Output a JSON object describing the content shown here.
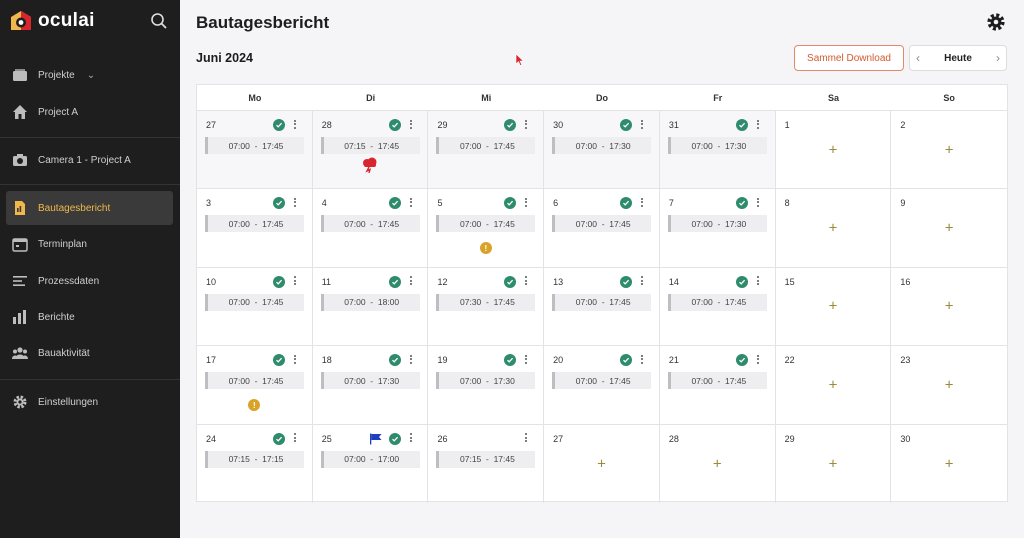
{
  "app": {
    "logo_text": "oculai"
  },
  "sidebar": {
    "items": [
      {
        "label": "Projekte",
        "icon": "projects-icon"
      },
      {
        "label": "Project A",
        "icon": "home-icon"
      },
      {
        "label": "Camera 1 - Project A",
        "icon": "camera-icon"
      },
      {
        "label": "Bautagesbericht",
        "icon": "report-icon",
        "active": true
      },
      {
        "label": "Terminplan",
        "icon": "calendar-icon"
      },
      {
        "label": "Prozessdaten",
        "icon": "list-icon"
      },
      {
        "label": "Berichte",
        "icon": "bar-chart-icon"
      },
      {
        "label": "Bauaktivität",
        "icon": "people-icon"
      },
      {
        "label": "Einstellungen",
        "icon": "gear-icon"
      }
    ]
  },
  "header": {
    "title": "Bautagesbericht",
    "month": "Juni 2024",
    "download_label": "Sammel Download",
    "today_label": "Heute"
  },
  "calendar": {
    "weekdays": [
      "Mo",
      "Di",
      "Mi",
      "Do",
      "Fr",
      "Sa",
      "So"
    ],
    "weeks": [
      [
        {
          "day": "27",
          "time": "07:00  -  17:45",
          "check": true,
          "ghost": true
        },
        {
          "day": "28",
          "time": "07:15  -  17:45",
          "check": true,
          "weather": true,
          "ghost": true
        },
        {
          "day": "29",
          "time": "07:00  -  17:45",
          "check": true,
          "ghost": true
        },
        {
          "day": "30",
          "time": "07:00  -  17:30",
          "check": true,
          "ghost": true
        },
        {
          "day": "31",
          "time": "07:00  -  17:30",
          "check": true,
          "ghost": true
        },
        {
          "day": "1",
          "plus": true
        },
        {
          "day": "2",
          "plus": true
        }
      ],
      [
        {
          "day": "3",
          "time": "07:00  -  17:45",
          "check": true
        },
        {
          "day": "4",
          "time": "07:00  -  17:45",
          "check": true
        },
        {
          "day": "5",
          "time": "07:00  -  17:45",
          "check": true,
          "warn": true
        },
        {
          "day": "6",
          "time": "07:00  -  17:45",
          "check": true
        },
        {
          "day": "7",
          "time": "07:00  -  17:30",
          "check": true
        },
        {
          "day": "8",
          "plus": true
        },
        {
          "day": "9",
          "plus": true
        }
      ],
      [
        {
          "day": "10",
          "time": "07:00  -  17:45",
          "check": true
        },
        {
          "day": "11",
          "time": "07:00  -  18:00",
          "check": true
        },
        {
          "day": "12",
          "time": "07:30  -  17:45",
          "check": true
        },
        {
          "day": "13",
          "time": "07:00  -  17:45",
          "check": true
        },
        {
          "day": "14",
          "time": "07:00  -  17:45",
          "check": true
        },
        {
          "day": "15",
          "plus": true
        },
        {
          "day": "16",
          "plus": true
        }
      ],
      [
        {
          "day": "17",
          "time": "07:00  -  17:45",
          "check": true,
          "warn": true
        },
        {
          "day": "18",
          "time": "07:00  -  17:30",
          "check": true
        },
        {
          "day": "19",
          "time": "07:00  -  17:30",
          "check": true
        },
        {
          "day": "20",
          "time": "07:00  -  17:45",
          "check": true
        },
        {
          "day": "21",
          "time": "07:00  -  17:45",
          "check": true
        },
        {
          "day": "22",
          "plus": true
        },
        {
          "day": "23",
          "plus": true
        }
      ],
      [
        {
          "day": "24",
          "time": "07:15  -  17:15",
          "check": true
        },
        {
          "day": "25",
          "time": "07:00  -  17:00",
          "check": true,
          "flag": true
        },
        {
          "day": "26",
          "time": "07:15  -  17:45",
          "check": false
        },
        {
          "day": "27",
          "plus": true
        },
        {
          "day": "28",
          "plus": true
        },
        {
          "day": "29",
          "plus": true
        },
        {
          "day": "30",
          "plus": true
        }
      ]
    ]
  },
  "colors": {
    "check": "#2e8b6b",
    "warn": "#d9a32a",
    "accent": "#f0b84a",
    "download": "#d35a30",
    "flag": "#1f3fbf",
    "weather": "#d8262e"
  }
}
